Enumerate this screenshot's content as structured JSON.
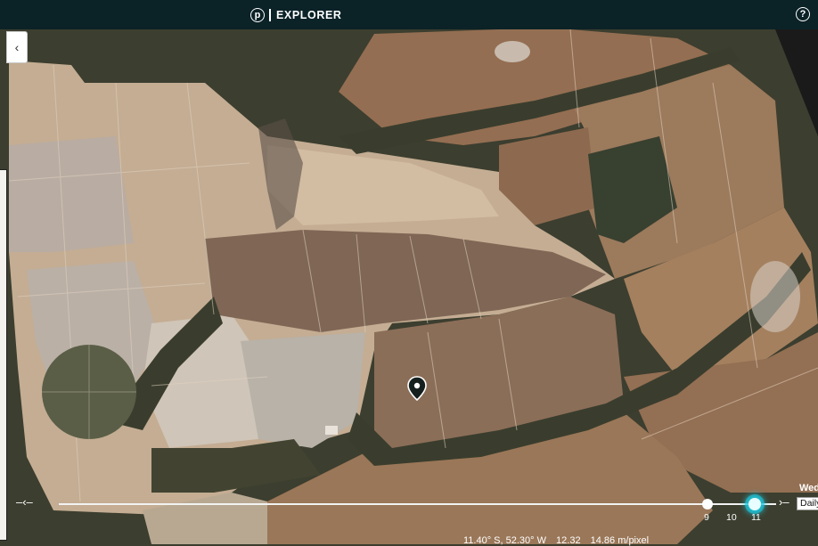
{
  "header": {
    "logo_letter": "p",
    "app_name": "EXPLORER",
    "help_symbol": "?"
  },
  "sidebar": {
    "collapse_symbol": "‹"
  },
  "timeline": {
    "ticks": [
      "9",
      "10",
      "11"
    ],
    "active_tick": "11",
    "date_partial": "Wed",
    "frequency_partial": "Daily"
  },
  "status": {
    "coordinates": "11.40° S, 52.30° W",
    "zoom": "12.32",
    "resolution": "14.86 m/pixel"
  },
  "colors": {
    "header_bg": "#0b2227",
    "accent": "#1fd2e8",
    "forest": "#3c3e2f",
    "field_light": "#c9b49c",
    "field_brown": "#8e7053"
  },
  "icons": {
    "logo": "planet-logo-icon",
    "help": "help-icon",
    "collapse": "chevron-left-icon",
    "marker": "location-pin-icon"
  }
}
